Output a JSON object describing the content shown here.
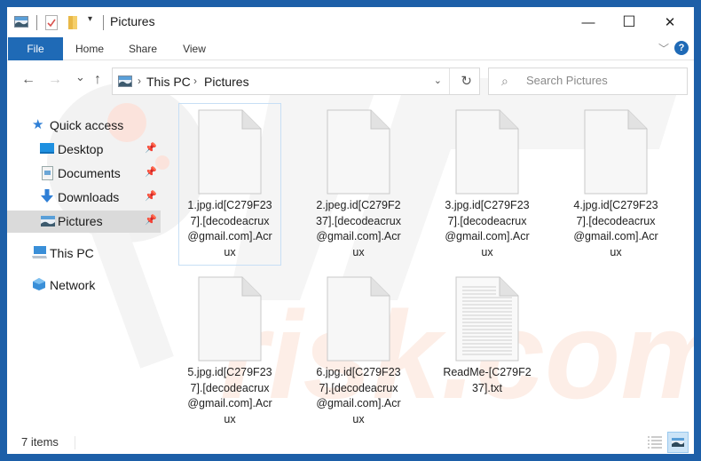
{
  "window": {
    "title": "Pictures",
    "controls": {
      "minimize": "—",
      "maximize": "☐",
      "close": "✕"
    }
  },
  "ribbon": {
    "tabs": [
      {
        "label": "File",
        "active": true
      },
      {
        "label": "Home"
      },
      {
        "label": "Share"
      },
      {
        "label": "View"
      }
    ],
    "expand_icon": "﹀",
    "help_label": "?"
  },
  "navigation": {
    "back": "←",
    "forward": "→",
    "recent": "⌄",
    "up": "↑",
    "breadcrumb": [
      "This PC",
      "Pictures"
    ],
    "crumb_separator": "›",
    "address_dropdown": "⌄",
    "refresh": "↻",
    "search_placeholder": "Search Pictures",
    "search_icon": "⌕"
  },
  "sidebar": {
    "items": [
      {
        "label": "Quick access",
        "icon": "star-icon"
      },
      {
        "label": "Desktop",
        "icon": "desktop-icon",
        "pinned": true
      },
      {
        "label": "Documents",
        "icon": "documents-icon",
        "pinned": true
      },
      {
        "label": "Downloads",
        "icon": "downloads-icon",
        "pinned": true
      },
      {
        "label": "Pictures",
        "icon": "pictures-icon",
        "pinned": true,
        "selected": true
      },
      {
        "label": "This PC",
        "icon": "computer-icon"
      },
      {
        "label": "Network",
        "icon": "network-icon"
      }
    ],
    "pin_glyph": "📌"
  },
  "files": [
    {
      "name": "1.jpg.id[C279F237].[decodeacrux@gmail.com].Acrux",
      "lines": [
        "1.jpg.id[C279F23",
        "7].[decodeacrux",
        "@gmail.com].Acr",
        "ux"
      ],
      "type": "blank"
    },
    {
      "name": "2.jpeg.id[C279F237].[decodeacrux@gmail.com].Acrux",
      "lines": [
        "2.jpeg.id[C279F2",
        "37].[decodeacrux",
        "@gmail.com].Acr",
        "ux"
      ],
      "type": "blank"
    },
    {
      "name": "3.jpg.id[C279F237].[decodeacrux@gmail.com].Acrux",
      "lines": [
        "3.jpg.id[C279F23",
        "7].[decodeacrux",
        "@gmail.com].Acr",
        "ux"
      ],
      "type": "blank"
    },
    {
      "name": "4.jpg.id[C279F237].[decodeacrux@gmail.com].Acrux",
      "lines": [
        "4.jpg.id[C279F23",
        "7].[decodeacrux",
        "@gmail.com].Acr",
        "ux"
      ],
      "type": "blank"
    },
    {
      "name": "5.jpg.id[C279F237].[decodeacrux@gmail.com].Acrux",
      "lines": [
        "5.jpg.id[C279F23",
        "7].[decodeacrux",
        "@gmail.com].Acr",
        "ux"
      ],
      "type": "blank"
    },
    {
      "name": "6.jpg.id[C279F237].[decodeacrux@gmail.com].Acrux",
      "lines": [
        "6.jpg.id[C279F23",
        "7].[decodeacrux",
        "@gmail.com].Acr",
        "ux"
      ],
      "type": "blank"
    },
    {
      "name": "ReadMe-[C279F237].txt",
      "lines": [
        "ReadMe-[C279F2",
        "37].txt"
      ],
      "type": "text"
    }
  ],
  "status": {
    "item_count": "7 items"
  },
  "colors": {
    "accent": "#1f6ab6",
    "window_border": "#1d5fa8",
    "selected_bg": "#dadada"
  }
}
